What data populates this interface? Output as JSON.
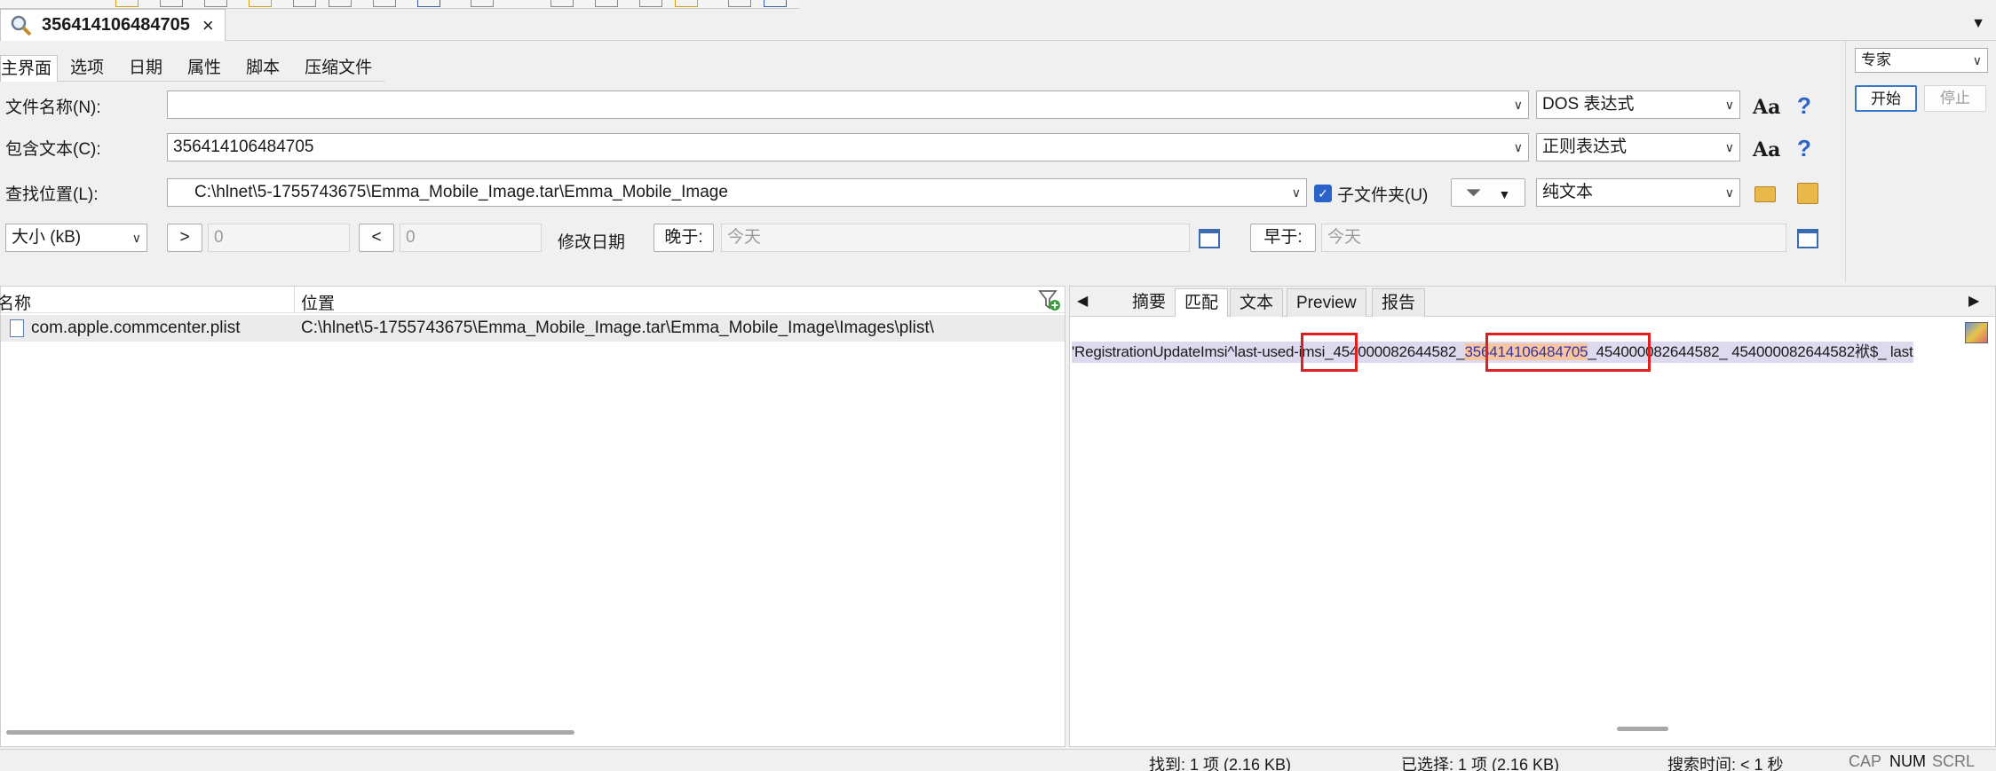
{
  "tab": {
    "title": "356414106484705",
    "close": "×"
  },
  "subtabs": [
    "主界面",
    "选项",
    "日期",
    "属性",
    "脚本",
    "压缩文件"
  ],
  "filename": {
    "label": "文件名称(N):",
    "value": "",
    "mode": "DOS 表达式",
    "aa": "Aa",
    "help": "?"
  },
  "content": {
    "label": "包含文本(C):",
    "value": "356414106484705",
    "mode": "正则表达式",
    "aa": "Aa",
    "help": "?"
  },
  "location": {
    "label": "查找位置(L):",
    "value": "C:\\hlnet\\5-1755743675\\Emma_Mobile_Image.tar\\Emma_Mobile_Image",
    "subfolders_label": "子文件夹(U)",
    "type": "纯文本"
  },
  "size": {
    "unit": "大小 (kB)",
    "gt": ">",
    "gt_value": "0",
    "lt": "<",
    "lt_value": "0"
  },
  "date": {
    "label": "修改日期",
    "after_btn": "晚于:",
    "after_value": "今天",
    "before_btn": "早于:",
    "before_value": "今天"
  },
  "right_panel": {
    "profile": "专家",
    "start": "开始",
    "stop": "停止"
  },
  "results": {
    "columns": {
      "name": "名称",
      "location": "位置"
    },
    "rows": [
      {
        "name": "com.apple.commcenter.plist",
        "location": "C:\\hlnet\\5-1755743675\\Emma_Mobile_Image.tar\\Emma_Mobile_Image\\Images\\plist\\"
      }
    ]
  },
  "preview": {
    "tabs": [
      "摘要",
      "匹配",
      "文本",
      "Preview",
      "报告"
    ],
    "active_tab": "匹配",
    "line": {
      "part1": "'RegistrationUpdateImsi^last-used-imsi_",
      "part2": "454000082644582_",
      "highlight": "356414106484705",
      "part3": "_454000082644582_ 454000082644582袱$_ last"
    }
  },
  "status": {
    "found": "找到: 1 项 (2.16 KB)",
    "selected": "已选择: 1 项 (2.16 KB)",
    "time": "搜索时间: < 1 秒",
    "cap": "CAP",
    "num": "NUM",
    "scrl": "SCRL"
  },
  "colors": {
    "accent": "#2a62c9",
    "highlight": "#f7c6a0",
    "row_bg": "#ddd9ee",
    "box": "#e02020"
  }
}
